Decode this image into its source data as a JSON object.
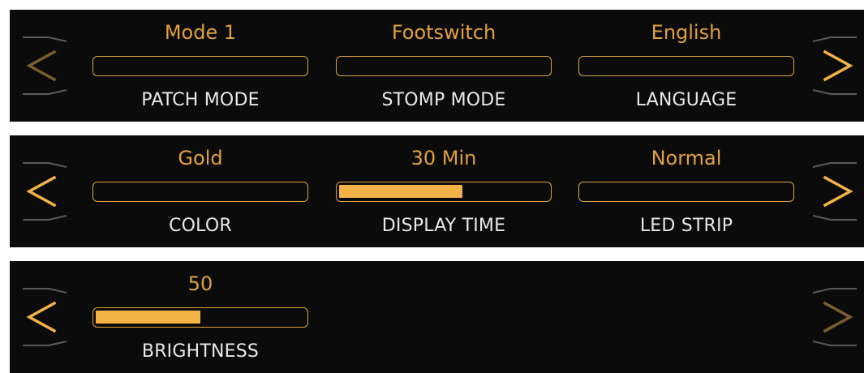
{
  "colors": {
    "accent": "#e0a13e",
    "fill": "#f2b248",
    "arrow_active": "#f2b248",
    "arrow_dim": "#7a5e2c",
    "bracket": "#5a5a5a",
    "label": "#e8e8e8",
    "panel_bg": "#0b0b0b"
  },
  "pages": [
    {
      "params": [
        {
          "value": "Mode 1",
          "label": "PATCH MODE"
        },
        {
          "value": "Footswitch",
          "label": "STOMP MODE"
        },
        {
          "value": "English",
          "label": "LANGUAGE"
        }
      ],
      "prev_enabled": false,
      "next_enabled": true
    },
    {
      "params": [
        {
          "value": "Gold",
          "label": "COLOR"
        },
        {
          "value": "30 Min",
          "label": "DISPLAY TIME",
          "level": 0.59
        },
        {
          "value": "Normal",
          "label": "LED STRIP"
        }
      ],
      "prev_enabled": true,
      "next_enabled": true
    },
    {
      "params": [
        {
          "value": "50",
          "label": "BRIGHTNESS",
          "level": 0.5
        }
      ],
      "prev_enabled": true,
      "next_enabled": false
    }
  ],
  "icons": {
    "prev": "chevron-left-icon",
    "next": "chevron-right-icon"
  }
}
